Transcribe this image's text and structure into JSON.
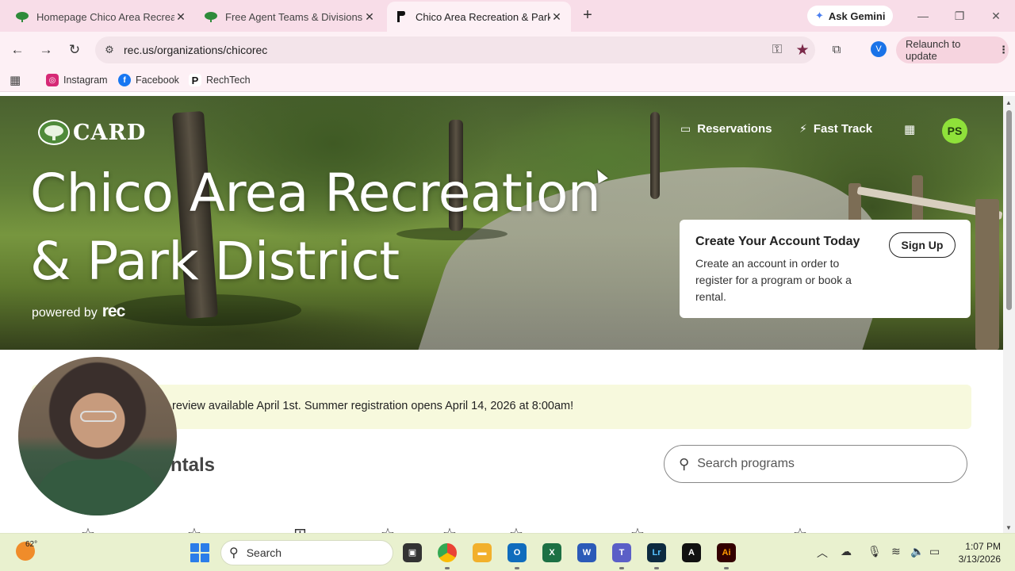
{
  "browser": {
    "tabs": [
      {
        "title": "Homepage Chico Area Recreati",
        "favicon": "card-tree-icon",
        "active": false
      },
      {
        "title": "Free Agent Teams & Divisions -",
        "favicon": "card-tree-icon",
        "active": false
      },
      {
        "title": "Chico Area Recreation & Park D",
        "favicon": "rec-icon",
        "active": true
      }
    ],
    "gemini_label": "Ask Gemini",
    "url": "rec.us/organizations/chicorec",
    "profile_initial": "V",
    "relaunch_label": "Relaunch to update",
    "bookmarks": [
      {
        "label": "Instagram",
        "icon": "instagram-icon",
        "color": "#d62976"
      },
      {
        "label": "Facebook",
        "icon": "facebook-icon",
        "color": "#1877f2"
      },
      {
        "label": "RechTech",
        "icon": "rec-icon",
        "color": "#111111"
      }
    ]
  },
  "page": {
    "logo_text": "CARD",
    "nav": {
      "reservations": "Reservations",
      "fast_track": "Fast Track",
      "user_initials": "PS"
    },
    "hero": {
      "title_line1": "Chico Area Recreation",
      "title_line2": "& Park District",
      "powered_by": "powered by",
      "powered_brand": "rec"
    },
    "account_card": {
      "heading": "Create Your Account Today",
      "body": "Create an account in order to register for a program or book a rental.",
      "signup_label": "Sign Up"
    },
    "announcement": "review available April 1st. Summer registration opens April 14, 2026 at 8:00am!",
    "section_title": "ntals",
    "search_placeholder": "Search programs",
    "accent": "#8fe13a"
  },
  "taskbar": {
    "temperature": "62°",
    "search_label": "Search",
    "time": "1:07 PM",
    "date": "3/13/2026"
  }
}
